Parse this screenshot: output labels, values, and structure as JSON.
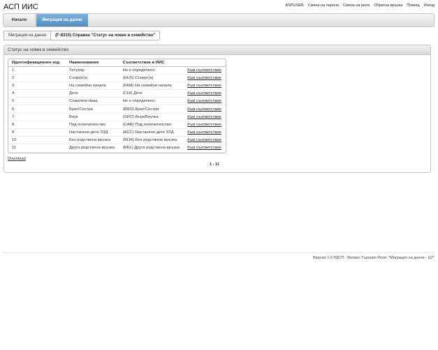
{
  "app": {
    "title": "АСП ИИС"
  },
  "top_links": [
    "ASPUSER",
    "Смяна на парола",
    "Смяна на роля",
    "Обратна връзка",
    "Помощ",
    "Изход"
  ],
  "nav": {
    "home": "Начало",
    "migration": "Миграция на данни"
  },
  "breadcrumb": {
    "first": "Миграция на данни",
    "current": "(F-8315) Справка \"Статус на човек в семейство\""
  },
  "panel": {
    "title": "Статус на човек в семейство"
  },
  "table": {
    "headers": [
      "Идентификационен код",
      "Наименование",
      "Съответствие в ИИС",
      ""
    ],
    "rows": [
      [
        "1",
        "Титуляр",
        "Не е определено",
        "Към съответствие"
      ],
      [
        "2",
        "Съпруг(а)",
        "(HUS) Съпруг(а)",
        "Към съответствие"
      ],
      [
        "3",
        "На семейни начала",
        "(FAM) На семейни начала",
        "Към съответствие"
      ],
      [
        "4",
        "Дете",
        "(CHI) Дете",
        "Към съответствие"
      ],
      [
        "5",
        "Съжителстващ",
        "Не е определено",
        "Към съответствие"
      ],
      [
        "6",
        "Брат/Сестра",
        "(BRO) Брат/Сестра",
        "Към съответствие"
      ],
      [
        "7",
        "Внук",
        "(GRC) Внук/Внучка",
        "Към съответствие"
      ],
      [
        "8",
        "Под попечителство",
        "(CAR) Под попечителство",
        "Към съответствие"
      ],
      [
        "9",
        "Настанено дете ЗЗД",
        "(ACC) Настанено дете ЗЗД",
        "Към съответствие"
      ],
      [
        "10",
        "Без родствена връзка",
        "(NOR) Без родствена връзка",
        "Към съответствие"
      ],
      [
        "11",
        "Друга родствена връзка",
        "(REL) Друга родствена връзка",
        "Към съответствие"
      ]
    ]
  },
  "download": "Download",
  "pager": "1 - 11",
  "footer": "Версия 1.0   РДСП - Велико Търново   Роля: \"Миграция на данни - ЦУ\""
}
